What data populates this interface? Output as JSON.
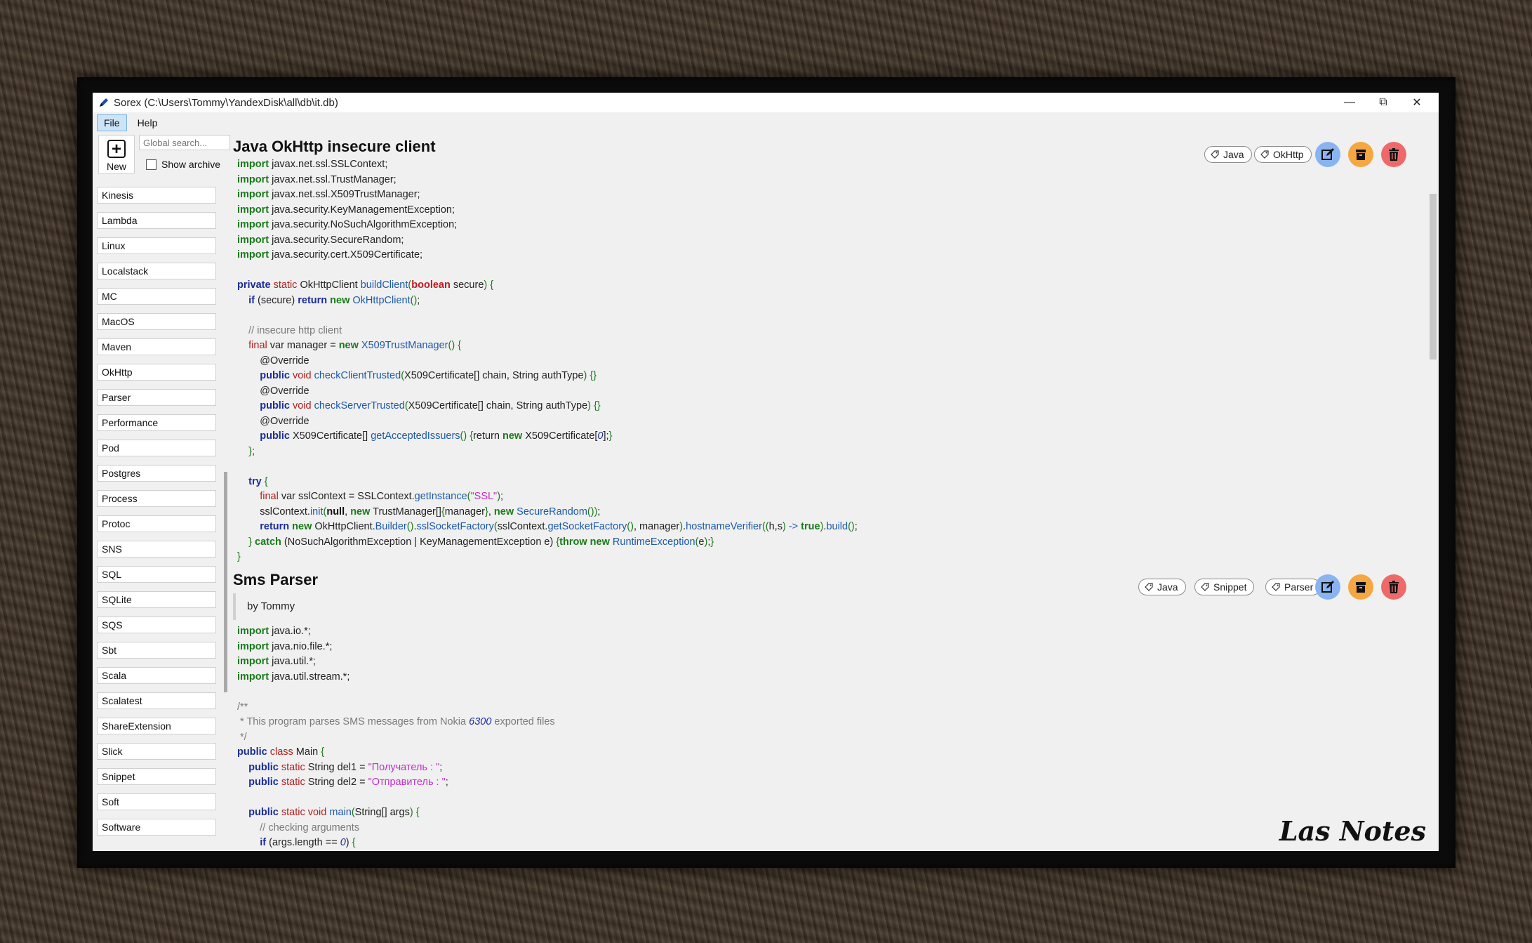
{
  "window": {
    "title": "Sorex (C:\\Users\\Tommy\\YandexDisk\\all\\db\\it.db)",
    "controls": {
      "minimize": "—",
      "maximize": "⧉",
      "close": "✕"
    }
  },
  "menu": [
    "File",
    "Help"
  ],
  "toolbar": {
    "new_label": "New",
    "search_placeholder": "Global search...",
    "show_archive_label": "Show archive",
    "show_archive_checked": false
  },
  "tags": [
    "Kinesis",
    "Lambda",
    "Linux",
    "Localstack",
    "MC",
    "MacOS",
    "Maven",
    "OkHttp",
    "Parser",
    "Performance",
    "Pod",
    "Postgres",
    "Process",
    "Protoc",
    "SNS",
    "SQL",
    "SQLite",
    "SQS",
    "Sbt",
    "Scala",
    "Scalatest",
    "ShareExtension",
    "Slick",
    "Snippet",
    "Soft",
    "Software"
  ],
  "notes": [
    {
      "title": "Java OkHttp insecure client",
      "tags": [
        "Java",
        "OkHttp"
      ],
      "code": [
        [
          [
            "kw",
            "import"
          ],
          [
            "t",
            " javax.net.ssl.SSLContext;"
          ]
        ],
        [
          [
            "kw",
            "import"
          ],
          [
            "t",
            " javax.net.ssl.TrustManager;"
          ]
        ],
        [
          [
            "kw",
            "import"
          ],
          [
            "t",
            " javax.net.ssl.X509TrustManager;"
          ]
        ],
        [
          [
            "kw",
            "import"
          ],
          [
            "t",
            " java.security.KeyManagementException;"
          ]
        ],
        [
          [
            "kw",
            "import"
          ],
          [
            "t",
            " java.security.NoSuchAlgorithmException;"
          ]
        ],
        [
          [
            "kw",
            "import"
          ],
          [
            "t",
            " java.security.SecureRandom;"
          ]
        ],
        [
          [
            "kw",
            "import"
          ],
          [
            "t",
            " java.security.cert.X509Certificate;"
          ]
        ],
        [],
        [
          [
            "kb",
            "private"
          ],
          [
            "t",
            " "
          ],
          [
            "mod",
            "static"
          ],
          [
            "t",
            " OkHttpClient "
          ],
          [
            "fn",
            "buildClient"
          ],
          [
            "br",
            "("
          ],
          [
            "bool",
            "boolean"
          ],
          [
            "t",
            " secure"
          ],
          [
            "br",
            ")"
          ],
          [
            "t",
            " "
          ],
          [
            "br",
            "{"
          ]
        ],
        [
          [
            "t",
            "    "
          ],
          [
            "kb",
            "if"
          ],
          [
            "t",
            " (secure) "
          ],
          [
            "kb",
            "return"
          ],
          [
            "t",
            " "
          ],
          [
            "kw",
            "new"
          ],
          [
            "t",
            " "
          ],
          [
            "cls",
            "OkHttpClient"
          ],
          [
            "br",
            "()"
          ],
          [
            "t",
            ";"
          ]
        ],
        [],
        [
          [
            "t",
            "    "
          ],
          [
            "cm",
            "// insecure http client"
          ]
        ],
        [
          [
            "t",
            "    "
          ],
          [
            "mod",
            "final"
          ],
          [
            "t",
            " var manager = "
          ],
          [
            "kw",
            "new"
          ],
          [
            "t",
            " "
          ],
          [
            "cls",
            "X509TrustManager"
          ],
          [
            "br",
            "()"
          ],
          [
            "t",
            " "
          ],
          [
            "br",
            "{"
          ]
        ],
        [
          [
            "t",
            "        @Override"
          ]
        ],
        [
          [
            "t",
            "        "
          ],
          [
            "kb",
            "public"
          ],
          [
            "t",
            " "
          ],
          [
            "mod",
            "void"
          ],
          [
            "t",
            " "
          ],
          [
            "fn",
            "checkClientTrusted"
          ],
          [
            "br",
            "("
          ],
          [
            "t",
            "X509Certificate[] chain, String authType"
          ],
          [
            "br",
            ")"
          ],
          [
            "t",
            " "
          ],
          [
            "br",
            "{}"
          ]
        ],
        [
          [
            "t",
            "        @Override"
          ]
        ],
        [
          [
            "t",
            "        "
          ],
          [
            "kb",
            "public"
          ],
          [
            "t",
            " "
          ],
          [
            "mod",
            "void"
          ],
          [
            "t",
            " "
          ],
          [
            "fn",
            "checkServerTrusted"
          ],
          [
            "br",
            "("
          ],
          [
            "t",
            "X509Certificate[] chain, String authType"
          ],
          [
            "br",
            ")"
          ],
          [
            "t",
            " "
          ],
          [
            "br",
            "{}"
          ]
        ],
        [
          [
            "t",
            "        @Override"
          ]
        ],
        [
          [
            "t",
            "        "
          ],
          [
            "kb",
            "public"
          ],
          [
            "t",
            " X509Certificate[] "
          ],
          [
            "fn",
            "getAcceptedIssuers"
          ],
          [
            "br",
            "()"
          ],
          [
            "t",
            " "
          ],
          [
            "br",
            "{"
          ],
          [
            "t",
            "return "
          ],
          [
            "kw",
            "new"
          ],
          [
            "t",
            " X509Certificate["
          ],
          [
            "num",
            "0"
          ],
          [
            "t",
            "];"
          ],
          [
            "br",
            "}"
          ]
        ],
        [
          [
            "t",
            "    "
          ],
          [
            "br",
            "}"
          ],
          [
            "t",
            ";"
          ]
        ],
        [],
        [
          [
            "t",
            "    "
          ],
          [
            "kb",
            "try"
          ],
          [
            "t",
            " "
          ],
          [
            "br",
            "{"
          ]
        ],
        [
          [
            "t",
            "        "
          ],
          [
            "mod",
            "final"
          ],
          [
            "t",
            " var sslContext = SSLContext."
          ],
          [
            "fn",
            "getInstance"
          ],
          [
            "br",
            "("
          ],
          [
            "str",
            "\"SSL\""
          ],
          [
            "br",
            ")"
          ],
          [
            "t",
            ";"
          ]
        ],
        [
          [
            "t",
            "        sslContext."
          ],
          [
            "fn",
            "init"
          ],
          [
            "br",
            "("
          ],
          [
            "t",
            ""
          ],
          [
            "kbb",
            "null"
          ],
          [
            "t",
            ", "
          ],
          [
            "kw",
            "new"
          ],
          [
            "t",
            " TrustManager[]"
          ],
          [
            "br",
            "{"
          ],
          [
            "t",
            "manager"
          ],
          [
            "br",
            "}"
          ],
          [
            "t",
            ", "
          ],
          [
            "kw",
            "new"
          ],
          [
            "t",
            " "
          ],
          [
            "cls",
            "SecureRandom"
          ],
          [
            "br",
            "()"
          ],
          [
            "br",
            ")"
          ],
          [
            "t",
            ";"
          ]
        ],
        [
          [
            "t",
            "        "
          ],
          [
            "kb",
            "return"
          ],
          [
            "t",
            " "
          ],
          [
            "kw",
            "new"
          ],
          [
            "t",
            " OkHttpClient."
          ],
          [
            "cls",
            "Builder"
          ],
          [
            "br",
            "()"
          ],
          [
            "t",
            "."
          ],
          [
            "fn",
            "sslSocketFactory"
          ],
          [
            "br",
            "("
          ],
          [
            "t",
            "sslContext."
          ],
          [
            "fn",
            "getSocketFactory"
          ],
          [
            "br",
            "()"
          ],
          [
            "t",
            ", manager"
          ],
          [
            "br",
            ")"
          ],
          [
            "t",
            "."
          ],
          [
            "fn",
            "hostnameVerifier"
          ],
          [
            "br",
            "(("
          ],
          [
            "t",
            "h,s"
          ],
          [
            "br",
            ")"
          ],
          [
            "t",
            " "
          ],
          [
            "fn",
            "->"
          ],
          [
            "t",
            " "
          ],
          [
            "kw",
            "true"
          ],
          [
            "br",
            ")"
          ],
          [
            "t",
            "."
          ],
          [
            "fn",
            "build"
          ],
          [
            "br",
            "()"
          ],
          [
            "t",
            ";"
          ]
        ],
        [
          [
            "t",
            "    "
          ],
          [
            "br",
            "}"
          ],
          [
            "t",
            " "
          ],
          [
            "kw",
            "catch"
          ],
          [
            "t",
            " (NoSuchAlgorithmException | KeyManagementException e) "
          ],
          [
            "br",
            "{"
          ],
          [
            "kw",
            "throw"
          ],
          [
            "t",
            " "
          ],
          [
            "kw",
            "new"
          ],
          [
            "t",
            " "
          ],
          [
            "cls",
            "RuntimeException"
          ],
          [
            "br",
            "("
          ],
          [
            "t",
            "e"
          ],
          [
            "br",
            ")"
          ],
          [
            "t",
            ";"
          ],
          [
            "br",
            "}"
          ]
        ],
        [
          [
            "br",
            "}"
          ]
        ]
      ]
    },
    {
      "title": "Sms Parser",
      "tags": [
        "Java",
        "Snippet",
        "Parser"
      ],
      "quote": "by Tommy",
      "code": [
        [
          [
            "kw",
            "import"
          ],
          [
            "t",
            " java.io.*;"
          ]
        ],
        [
          [
            "kw",
            "import"
          ],
          [
            "t",
            " java.nio.file.*;"
          ]
        ],
        [
          [
            "kw",
            "import"
          ],
          [
            "t",
            " java.util.*;"
          ]
        ],
        [
          [
            "kw",
            "import"
          ],
          [
            "t",
            " java.util.stream.*;"
          ]
        ],
        [],
        [
          [
            "cm",
            "/**"
          ]
        ],
        [
          [
            "cm",
            " * This program parses SMS messages from Nokia "
          ],
          [
            "num",
            "6300"
          ],
          [
            "cm",
            " exported files"
          ]
        ],
        [
          [
            "cm",
            " */"
          ]
        ],
        [
          [
            "kb",
            "public"
          ],
          [
            "t",
            " "
          ],
          [
            "mod",
            "class"
          ],
          [
            "t",
            " Main "
          ],
          [
            "br",
            "{"
          ]
        ],
        [
          [
            "t",
            "    "
          ],
          [
            "kb",
            "public"
          ],
          [
            "t",
            " "
          ],
          [
            "mod",
            "static"
          ],
          [
            "t",
            " String del1 = "
          ],
          [
            "str",
            "\"Получатель : \""
          ],
          [
            "t",
            ";"
          ]
        ],
        [
          [
            "t",
            "    "
          ],
          [
            "kb",
            "public"
          ],
          [
            "t",
            " "
          ],
          [
            "mod",
            "static"
          ],
          [
            "t",
            " String del2 = "
          ],
          [
            "str",
            "\"Отправитель : \""
          ],
          [
            "t",
            ";"
          ]
        ],
        [],
        [
          [
            "t",
            "    "
          ],
          [
            "kb",
            "public"
          ],
          [
            "t",
            " "
          ],
          [
            "mod",
            "static"
          ],
          [
            "t",
            " "
          ],
          [
            "mod",
            "void"
          ],
          [
            "t",
            " "
          ],
          [
            "fn",
            "main"
          ],
          [
            "br",
            "("
          ],
          [
            "t",
            "String[] args"
          ],
          [
            "br",
            ")"
          ],
          [
            "t",
            " "
          ],
          [
            "br",
            "{"
          ]
        ],
        [
          [
            "t",
            "        "
          ],
          [
            "cm",
            "// checking arguments"
          ]
        ],
        [
          [
            "t",
            "        "
          ],
          [
            "kb",
            "if"
          ],
          [
            "t",
            " (args.length == "
          ],
          [
            "num",
            "0"
          ],
          [
            "t",
            ") "
          ],
          [
            "br",
            "{"
          ]
        ]
      ]
    }
  ],
  "brand": "Las Notes",
  "colors": {
    "edit": "#8ab4f0",
    "archive": "#f5a742",
    "delete": "#ee6a6a"
  },
  "icons": {
    "tag": "tag-icon",
    "edit": "edit-icon",
    "archive": "archive-icon",
    "delete": "trash-icon"
  }
}
